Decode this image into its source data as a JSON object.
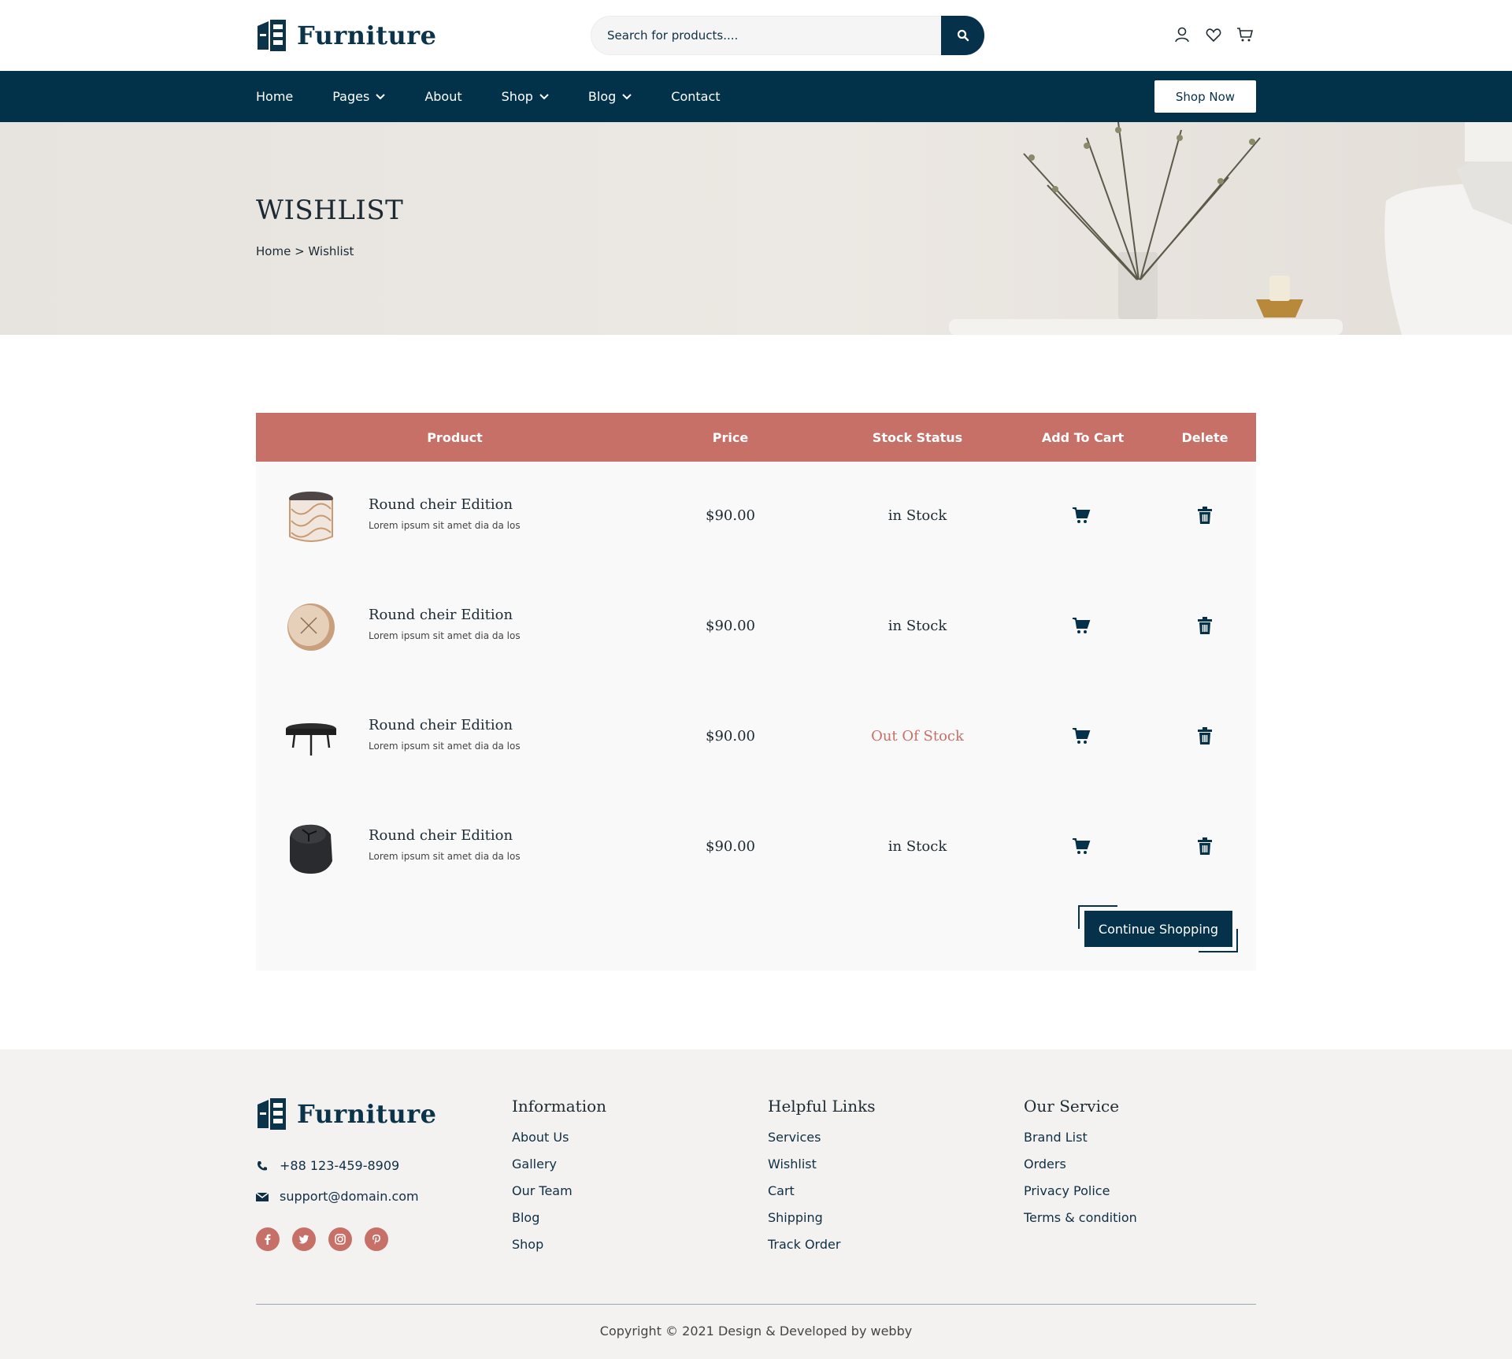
{
  "brand": {
    "name": "Furniture"
  },
  "search": {
    "placeholder": "Search for products...."
  },
  "nav": {
    "items": [
      {
        "label": "Home",
        "dropdown": false
      },
      {
        "label": "Pages",
        "dropdown": true
      },
      {
        "label": "About",
        "dropdown": false
      },
      {
        "label": "Shop",
        "dropdown": true
      },
      {
        "label": "Blog",
        "dropdown": true
      },
      {
        "label": "Contact",
        "dropdown": false
      }
    ],
    "cta": "Shop Now"
  },
  "hero": {
    "title": "WISHLIST",
    "breadcrumb": "Home > Wishlist"
  },
  "table": {
    "headers": {
      "product": "Product",
      "price": "Price",
      "stock": "Stock Status",
      "cart": "Add To Cart",
      "delete": "Delete"
    },
    "rows": [
      {
        "name": "Round cheir Edition",
        "desc": "Lorem ipsum sit amet dia da los",
        "price": "$90.00",
        "stock": "in Stock",
        "in_stock": true,
        "image": "stool-icon"
      },
      {
        "name": "Round cheir Edition",
        "desc": "Lorem ipsum sit amet dia da los",
        "price": "$90.00",
        "stock": "in Stock",
        "in_stock": true,
        "image": "wall-clock-icon"
      },
      {
        "name": "Round cheir Edition",
        "desc": "Lorem ipsum sit amet dia da los",
        "price": "$90.00",
        "stock": "Out Of Stock",
        "in_stock": false,
        "image": "side-table-icon"
      },
      {
        "name": "Round cheir Edition",
        "desc": "Lorem ipsum sit amet dia da los",
        "price": "$90.00",
        "stock": "in Stock",
        "in_stock": true,
        "image": "table-clock-icon"
      }
    ],
    "continue_label": "Continue Shopping"
  },
  "footer": {
    "brand": "Furniture",
    "phone": "+88 123-459-8909",
    "email": "support@domain.com",
    "columns": [
      {
        "title": "Information",
        "links": [
          "About Us",
          "Gallery",
          "Our Team",
          "Blog",
          "Shop"
        ]
      },
      {
        "title": "Helpful Links",
        "links": [
          "Services",
          "Wishlist",
          "Cart",
          "Shipping",
          "Track Order"
        ]
      },
      {
        "title": "Our Service",
        "links": [
          "Brand List",
          "Orders",
          "Privacy Police",
          "Terms & condition"
        ]
      }
    ],
    "socials": [
      "facebook-icon",
      "twitter-icon",
      "instagram-icon",
      "pinterest-icon"
    ],
    "copyright": "Copyright © 2021 Design & Developed by webby"
  },
  "colors": {
    "navy": "#02324a",
    "accent": "#c77068"
  }
}
